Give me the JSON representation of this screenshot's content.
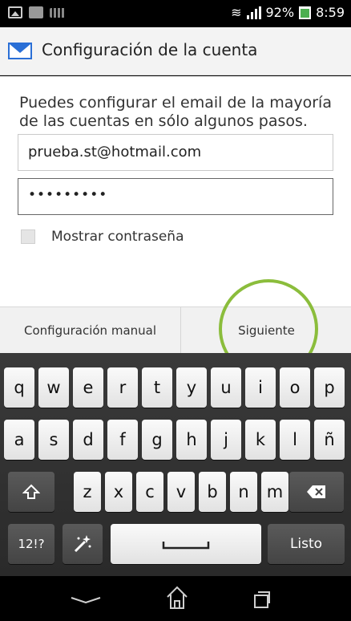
{
  "statusbar": {
    "battery": "92%",
    "time": "8:59"
  },
  "header": {
    "title": "Configuración de la cuenta"
  },
  "main": {
    "intro": "Puedes configurar el email de la mayoría de las cuentas en sólo algunos pasos.",
    "email_value": "prueba.st@hotmail.com",
    "password_value": "•••••••••",
    "show_password_label": "Mostrar contraseña",
    "show_password_checked": false
  },
  "buttons": {
    "manual": "Configuración manual",
    "next": "Siguiente"
  },
  "keyboard": {
    "row1": [
      "q",
      "w",
      "e",
      "r",
      "t",
      "y",
      "u",
      "i",
      "o",
      "p"
    ],
    "row2": [
      "a",
      "s",
      "d",
      "f",
      "g",
      "h",
      "j",
      "k",
      "l",
      "ñ"
    ],
    "row3": [
      "z",
      "x",
      "c",
      "v",
      "b",
      "n",
      "m"
    ],
    "symbols": "12!?",
    "done": "Listo"
  },
  "colors": {
    "accent": "#8bbd3c",
    "mail": "#2a6fd6"
  }
}
